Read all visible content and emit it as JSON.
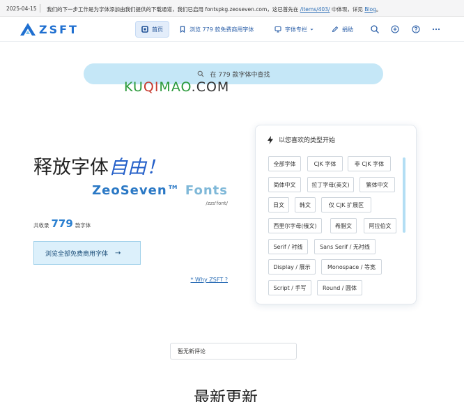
{
  "notice": {
    "date": "2025-04-15",
    "text_before": "我们的下一步工作是为字体添加由我们提供的下载通道，我们已启用 fontspkg.zeoseven.com，这已首先在",
    "link_items": "/items/403/",
    "text_middle": "中体现，详见",
    "link_blog": "Blog",
    "text_end": "。"
  },
  "header": {
    "logo_text": "ZSFT",
    "nav": {
      "home": "首页",
      "browse": "浏览 779 款免费商用字体",
      "columns": "字体专栏",
      "donate": "捐助"
    }
  },
  "search": {
    "placeholder": "在 779 款字体中查找"
  },
  "watermark": {
    "part1": "KU",
    "part2": "QI",
    "part3": "MAO",
    "part4": ".COM"
  },
  "hero": {
    "title_plain": "释放字体",
    "title_emph": "自由！",
    "brand_a": "ZeoSeven™",
    "brand_b": "Fonts",
    "brand_sub": "/zzs'font/",
    "count_prefix": "共收录",
    "count_value": "779",
    "count_suffix": "款字体",
    "browse_button": "浏览全部免费商用字体",
    "why_link": "* Why ZSFT ?"
  },
  "categories": {
    "heading": "以您喜欢的类型开始",
    "tags": [
      "全部字体",
      "CJK 字体",
      "非 CJK 字体",
      "简体中文",
      "拉丁字母(英文)",
      "繁体中文",
      "日文",
      "韩文",
      "仅 CJK 扩展区",
      "西里尔字母(俄文)",
      "希腊文",
      "阿拉伯文",
      "Serif / 衬线",
      "Sans Serif / 无衬线",
      "Display / 展示",
      "Monospace / 等宽",
      "Script / 手写",
      "Round / 圆体"
    ]
  },
  "comments": {
    "empty_text": "暂无新评论"
  },
  "latest": {
    "heading": "最新更新"
  },
  "colors": {
    "accent": "#1f6fd0",
    "search_bg": "#c5e7f7",
    "button_bg": "#dcf0fb"
  }
}
